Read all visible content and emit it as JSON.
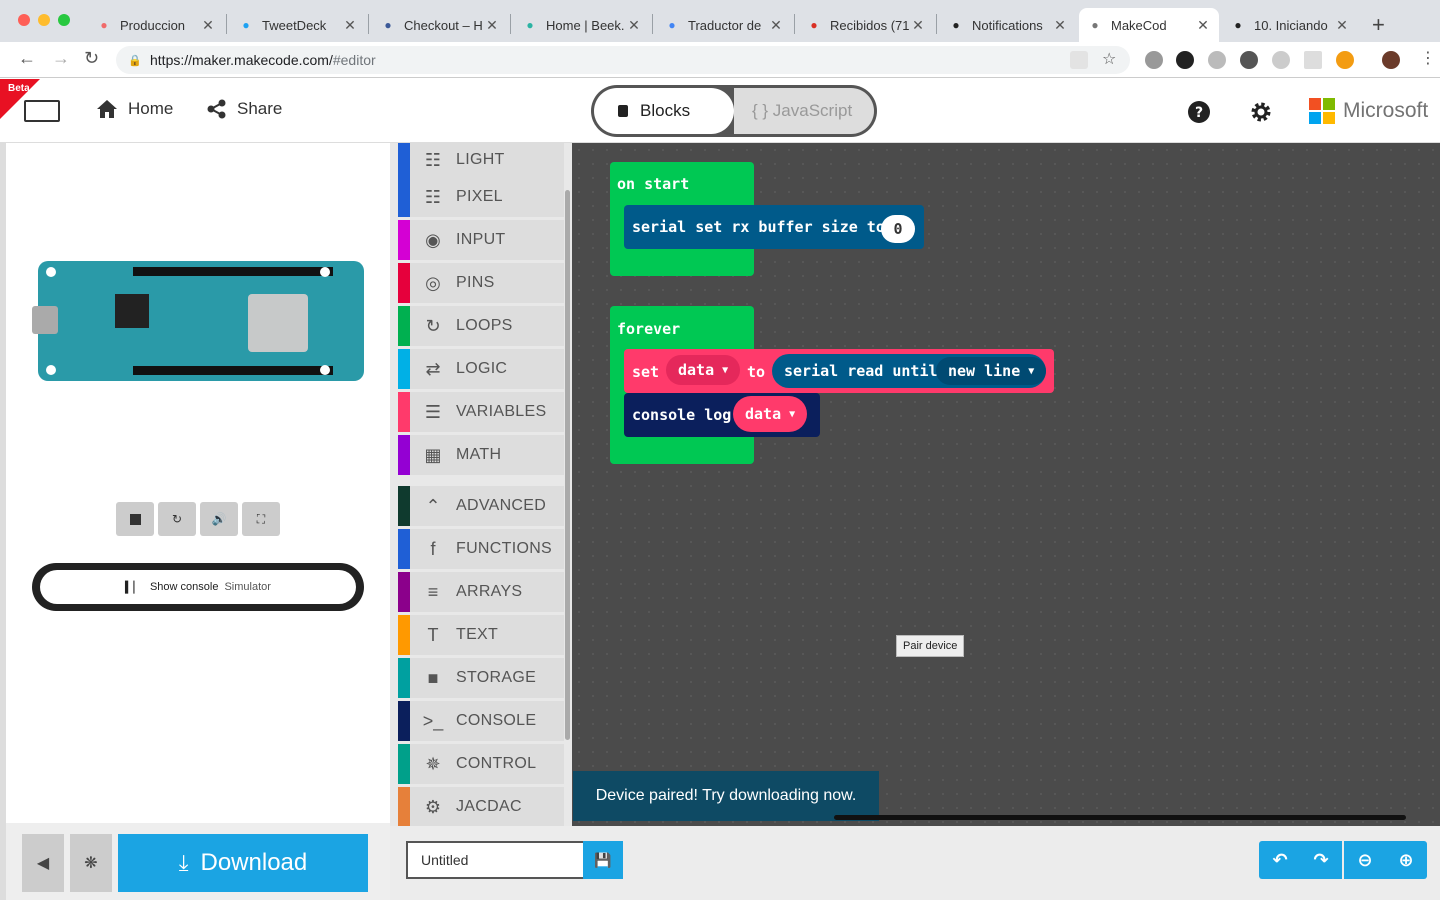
{
  "browser": {
    "tabs": [
      {
        "title": "Produccion",
        "favicon": "asana-icon",
        "color": "#f06a6a"
      },
      {
        "title": "TweetDeck",
        "favicon": "tweetdeck-icon",
        "color": "#1da1f2"
      },
      {
        "title": "Checkout – H",
        "favicon": "checkout-icon",
        "color": "#3b5998"
      },
      {
        "title": "Home | Beek.",
        "favicon": "beek-icon",
        "color": "#2bb3a3"
      },
      {
        "title": "Traductor de",
        "favicon": "translate-icon",
        "color": "#4285f4"
      },
      {
        "title": "Recibidos (71",
        "favicon": "gmail-icon",
        "color": "#d93025"
      },
      {
        "title": "Notifications",
        "favicon": "github-icon",
        "color": "#222"
      },
      {
        "title": "MakeCod",
        "favicon": "makecode-icon",
        "color": "#777"
      },
      {
        "title": "10. Iniciando",
        "favicon": "github-icon",
        "color": "#222"
      }
    ],
    "url_host": "https://maker.makecode.com/",
    "url_path": "#editor"
  },
  "header": {
    "beta_label": "Beta",
    "home_label": "Home",
    "share_label": "Share",
    "blocks_label": "Blocks",
    "javascript_label": "{ } JavaScript",
    "brand": "Microsoft"
  },
  "simulator": {
    "console_label": "Show console",
    "console_sub": "Simulator",
    "download_label": "Download"
  },
  "toolbox": {
    "categories": [
      {
        "label": "LIGHT",
        "icon": "grid-icon",
        "color": "#1f5fd6"
      },
      {
        "label": "PIXEL",
        "icon": "grid-icon",
        "color": "#1f5fd6"
      },
      {
        "label": "INPUT",
        "icon": "target-icon",
        "color": "#d400d4"
      },
      {
        "label": "PINS",
        "icon": "pins-icon",
        "color": "#e6003c"
      },
      {
        "label": "LOOPS",
        "icon": "loop-icon",
        "color": "#00b050"
      },
      {
        "label": "LOGIC",
        "icon": "shuffle-icon",
        "color": "#00b0e6"
      },
      {
        "label": "VARIABLES",
        "icon": "list-icon",
        "color": "#ff3a6b"
      },
      {
        "label": "MATH",
        "icon": "calculator-icon",
        "color": "#9400d3"
      },
      {
        "label": "ADVANCED",
        "icon": "chevron-up-icon",
        "color": "#0f3a2e"
      },
      {
        "label": "FUNCTIONS",
        "icon": "function-icon",
        "color": "#1f5fd6"
      },
      {
        "label": "ARRAYS",
        "icon": "ordered-list-icon",
        "color": "#8b008b"
      },
      {
        "label": "TEXT",
        "icon": "text-icon",
        "color": "#ff9900"
      },
      {
        "label": "STORAGE",
        "icon": "folder-icon",
        "color": "#00a0a0"
      },
      {
        "label": "CONSOLE",
        "icon": "terminal-icon",
        "color": "#0b1f5c"
      },
      {
        "label": "CONTROL",
        "icon": "spinner-icon",
        "color": "#00a08a"
      },
      {
        "label": "JACDAC",
        "icon": "gear-icon",
        "color": "#e6803a"
      }
    ]
  },
  "workspace": {
    "on_start_label": "on start",
    "serial_rx_label": "serial set rx buffer size to",
    "rx_value": "0",
    "forever_label": "forever",
    "set_label": "set",
    "var_name": "data",
    "to_label": "to",
    "serial_read_label": "serial read until",
    "new_line_label": "new line",
    "console_log_label": "console log",
    "tooltip": "Pair device",
    "toast": "Device paired! Try downloading now."
  },
  "bottom": {
    "project_name": "Untitled"
  }
}
